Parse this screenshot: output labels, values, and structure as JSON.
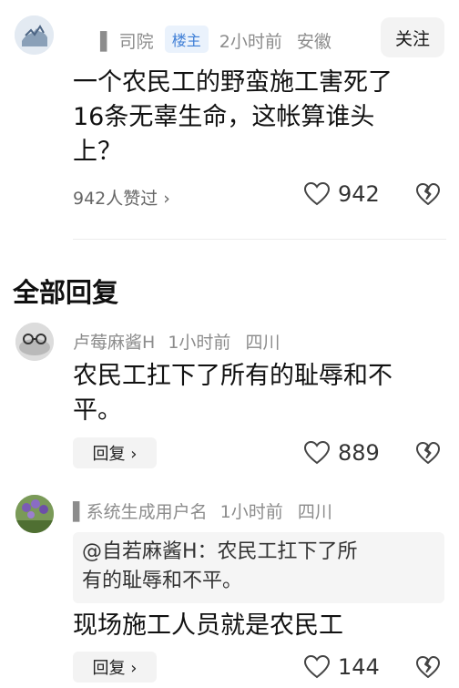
{
  "post": {
    "author_name": "▌ 司院",
    "badge": "楼主",
    "time": "2小时前",
    "location": "安徽",
    "follow_label": "关注",
    "content_lines": [
      "一个农民工的野蛮施工害死了",
      "16条无辜生命，这帐算谁头",
      "上？"
    ],
    "likes_link": "942人赞过 ›",
    "like_count": "942",
    "icons": {
      "like": "heart-outline-icon",
      "dislike": "broken-heart-icon",
      "arrow": "chevron-right-icon"
    }
  },
  "section_title": "全部回复",
  "replies": [
    {
      "author_name": "卢莓麻酱H",
      "time": "1小时前",
      "location": "四川",
      "content_lines": [
        "农民工扛下了所有的耻辱和不",
        "平。"
      ],
      "reply_label": "回复 ›",
      "like_count": "889"
    },
    {
      "author_name": "▌系统生成用户名",
      "time": "1小时前",
      "location": "四川",
      "quote_lines": [
        "@自若麻酱H：农民工扛下了所",
        "有的耻辱和不平。"
      ],
      "content_lines": [
        "现场施工人员就是农民工"
      ],
      "reply_label": "回复 ›",
      "like_count": "144"
    }
  ]
}
